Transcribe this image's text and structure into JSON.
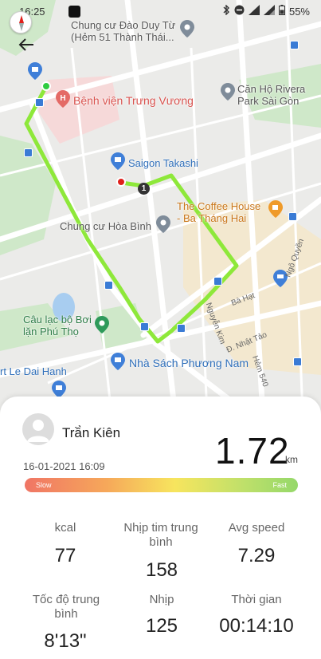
{
  "status": {
    "time": "16:25",
    "battery": "55%"
  },
  "map": {
    "pois": {
      "chung_cu_dao_duy_tu": "Chung cư Đào Duy Từ\n(Hẻm 51 Thành Thái...",
      "benh_vien": "Bệnh viện Trưng Vương",
      "can_ho_rivera": "Căn Hộ Rivera\nPark Sài Gòn",
      "saigon_takashi": "Saigon Takashi",
      "coffee_house": "The Coffee House\n- Ba Tháng Hai",
      "chung_cu_hoa_binh": "Chung cư Hòa Bình",
      "cau_lac_bo": "Câu lạc bộ Bơi\nlặn Phú Thọ",
      "nha_sach": "Nhà Sách Phương Nam",
      "le_dai_hanh": "rt Le Dai Hanh"
    },
    "streets": {
      "ngo_quyen": "Ngô Quyền",
      "ba_hat": "Bà Hạt",
      "nguyen_kim": "Nguyễn Kim",
      "nhat_tao": "Đ. Nhật Tảo",
      "hem_540": "Hẻm 540"
    },
    "step_marker": "1",
    "colors": {
      "route": "#8ee83a",
      "start": "#2ecc40",
      "end": "#e0201b"
    }
  },
  "workout": {
    "user_name": "Trầ̀n Kiên",
    "datetime": "16-01-2021 16:09",
    "distance": "1.72",
    "distance_unit": "km",
    "speed_bar": {
      "slow_label": "Slow",
      "fast_label": "Fast"
    },
    "stats": [
      {
        "label": "kcal",
        "value": "77"
      },
      {
        "label": "Nhịp tim trung bình",
        "value": "158"
      },
      {
        "label": "Avg speed",
        "value": "7.29"
      },
      {
        "label": "Tốc độ trung bình",
        "value": "8'13\""
      },
      {
        "label": "Nhịp",
        "value": "125"
      },
      {
        "label": "Thời gian",
        "value": "00:14:10"
      }
    ]
  }
}
